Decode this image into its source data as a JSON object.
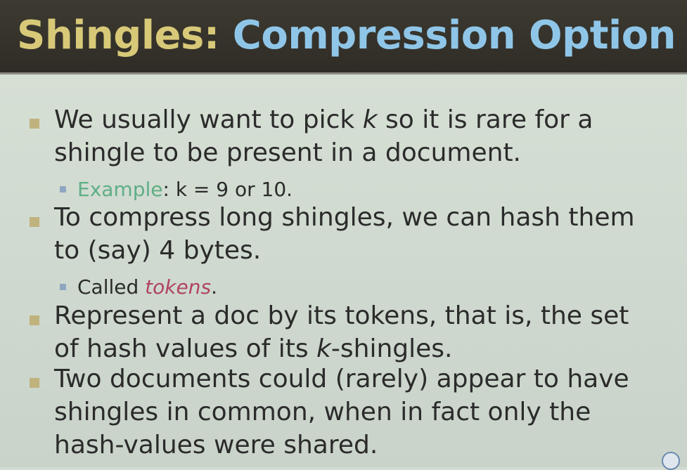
{
  "title": {
    "part1": "Shingles:",
    "part2": "Compression Option"
  },
  "bullets": [
    {
      "line1_a": "We usually want to pick ",
      "line1_k": "k",
      "line1_b": " so it is rare for a",
      "line2": "shingle to be present in a document."
    },
    {
      "sub_label": "Example",
      "sub_rest": ": k = 9 or 10."
    },
    {
      "line1": "To compress long shingles, we can hash them",
      "line2": "to (say) 4 bytes."
    },
    {
      "sub_a": "Called ",
      "sub_tok": "tokens",
      "sub_b": "."
    },
    {
      "line1": "Represent a doc by its tokens, that is, the set",
      "line2_a": "of hash values of its ",
      "line2_k": "k",
      "line2_b": "-shingles."
    },
    {
      "line1": "Two documents could (rarely) appear to have",
      "line2": "shingles in common, when in fact only the",
      "line3": "hash-values were shared."
    }
  ],
  "colors": {
    "title_bar": "#35322b",
    "title_part1": "#d7c978",
    "title_part2": "#8fc6e8",
    "body_bg": "#d3dcd2",
    "text": "#2b2b2b",
    "example": "#5fae86",
    "tokens": "#b0435d"
  },
  "icons": {
    "bullet_level1": "square-bullet",
    "bullet_level2": "small-square-bullet",
    "corner": "channel-logo"
  }
}
